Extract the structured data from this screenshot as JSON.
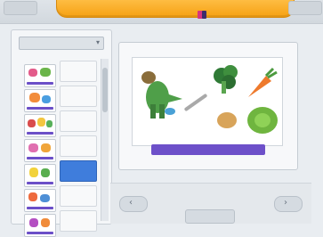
{
  "header": {
    "left_tab_icon": "menu-icon",
    "right_tab_icon": "close-icon",
    "accent_color": "#f6a113"
  },
  "sidebar": {
    "dropdown_value": "",
    "dropdown_icon": "chevron-down-icon",
    "caption": "",
    "categories": [
      {
        "label": "",
        "selected": false
      },
      {
        "label": "",
        "selected": false
      },
      {
        "label": "",
        "selected": false
      },
      {
        "label": "",
        "selected": false
      },
      {
        "label": "",
        "selected": true
      },
      {
        "label": "",
        "selected": false
      },
      {
        "label": "",
        "selected": false
      }
    ]
  },
  "scene": {
    "items": [
      "dinosaur-sticker",
      "broccoli-sticker",
      "carrot-sticker",
      "lettuce-sticker",
      "bread-sticker",
      "paintbrush-sticker"
    ],
    "bar_color": "#6d50c9"
  },
  "footer": {
    "caption_line1": "",
    "caption_line2": "",
    "prev_icon": "arrow-left-icon",
    "next_icon": "arrow-right-icon"
  }
}
